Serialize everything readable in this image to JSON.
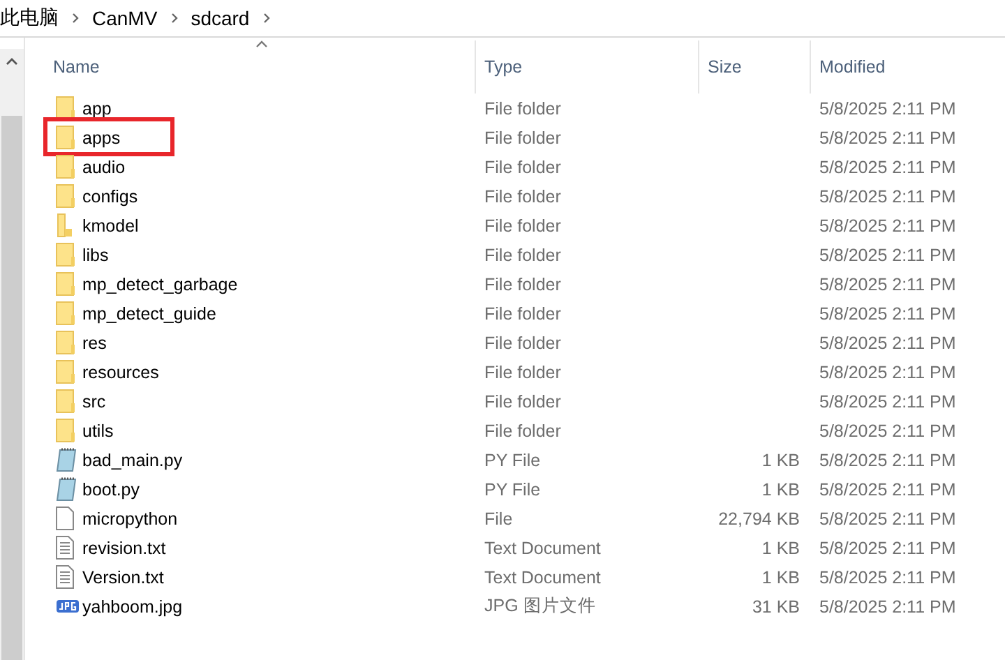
{
  "breadcrumb": [
    {
      "label": "此电脑"
    },
    {
      "label": "CanMV"
    },
    {
      "label": "sdcard"
    }
  ],
  "columns": [
    {
      "label": "Name",
      "sorted": true
    },
    {
      "label": "Type",
      "sorted": false
    },
    {
      "label": "Size",
      "sorted": false
    },
    {
      "label": "Modified",
      "sorted": false
    }
  ],
  "rows": [
    {
      "name": "app",
      "kind": "folder",
      "type": "File folder",
      "modified": "5/8/2025 2:11 PM",
      "highlighted": false
    },
    {
      "name": "apps",
      "kind": "folder",
      "type": "File folder",
      "modified": "5/8/2025 2:11 PM",
      "highlighted": true
    },
    {
      "name": "audio",
      "kind": "folder",
      "type": "File folder",
      "modified": "5/8/2025 2:11 PM",
      "highlighted": false
    },
    {
      "name": "configs",
      "kind": "folder",
      "type": "File folder",
      "modified": "5/8/2025 2:11 PM",
      "highlighted": false
    },
    {
      "name": "kmodel",
      "kind": "folder-narrow",
      "type": "File folder",
      "modified": "5/8/2025 2:11 PM",
      "highlighted": false
    },
    {
      "name": "libs",
      "kind": "folder",
      "type": "File folder",
      "modified": "5/8/2025 2:11 PM",
      "highlighted": false
    },
    {
      "name": "mp_detect_garbage",
      "kind": "folder",
      "type": "File folder",
      "modified": "5/8/2025 2:11 PM",
      "highlighted": false
    },
    {
      "name": "mp_detect_guide",
      "kind": "folder",
      "type": "File folder",
      "modified": "5/8/2025 2:11 PM",
      "highlighted": false
    },
    {
      "name": "res",
      "kind": "folder",
      "type": "File folder",
      "modified": "5/8/2025 2:11 PM",
      "highlighted": false
    },
    {
      "name": "resources",
      "kind": "folder",
      "type": "File folder",
      "modified": "5/8/2025 2:11 PM",
      "highlighted": false
    },
    {
      "name": "src",
      "kind": "folder",
      "type": "File folder",
      "modified": "5/8/2025 2:11 PM",
      "highlighted": false
    },
    {
      "name": "utils",
      "kind": "folder",
      "type": "File folder",
      "modified": "5/8/2025 2:11 PM",
      "highlighted": false
    },
    {
      "name": "bad_main.py",
      "kind": "python",
      "type": "PY File",
      "size": "1 KB",
      "modified": "5/8/2025 2:11 PM",
      "highlighted": false
    },
    {
      "name": "boot.py",
      "kind": "python",
      "type": "PY File",
      "size": "1 KB",
      "modified": "5/8/2025 2:11 PM",
      "highlighted": false
    },
    {
      "name": "micropython",
      "kind": "file",
      "type": "File",
      "size": "22,794 KB",
      "modified": "5/8/2025 2:11 PM",
      "highlighted": false
    },
    {
      "name": "revision.txt",
      "kind": "text",
      "type": "Text Document",
      "size": "1 KB",
      "modified": "5/8/2025 2:11 PM",
      "highlighted": false
    },
    {
      "name": "Version.txt",
      "kind": "text",
      "type": "Text Document",
      "size": "1 KB",
      "modified": "5/8/2025 2:11 PM",
      "highlighted": false
    },
    {
      "name": "yahboom.jpg",
      "kind": "image",
      "type": "JPG 图片文件",
      "size": "31 KB",
      "modified": "5/8/2025 2:11 PM",
      "highlighted": false
    }
  ]
}
